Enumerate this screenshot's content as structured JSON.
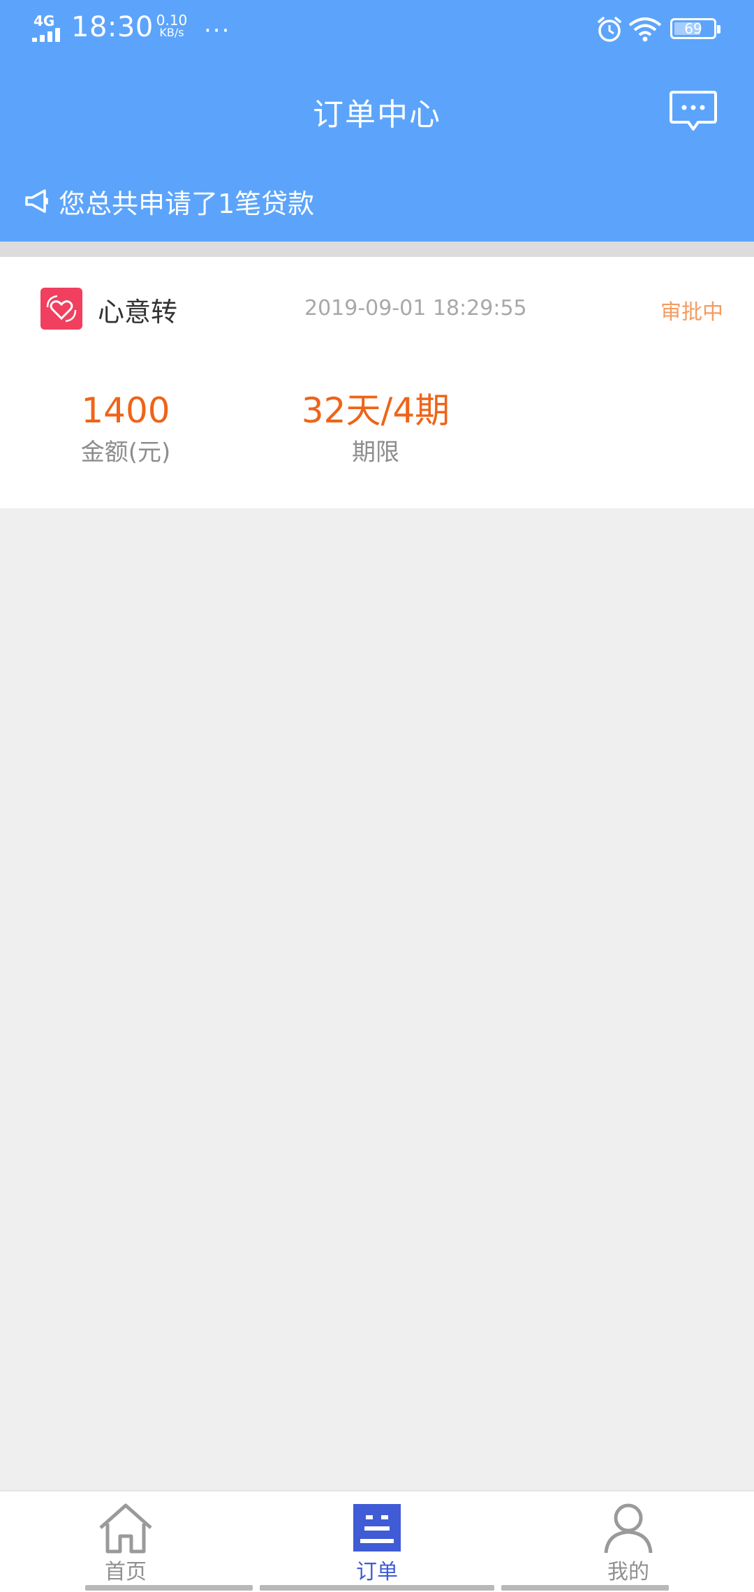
{
  "status_bar": {
    "network": "4G",
    "time": "18:30",
    "speed_value": "0.10",
    "speed_unit": "KB/s",
    "more": "···",
    "battery": "69",
    "battery_level": 0.69
  },
  "header": {
    "title": "订单中心",
    "message_icon": "chat-bubble-icon",
    "notice_icon": "megaphone-icon",
    "notice_text": "您总共申请了1笔贷款"
  },
  "order": {
    "app_icon": "heart-swap-icon",
    "app_name": "心意转",
    "time": "2019-09-01 18:29:55",
    "status": "审批中",
    "amount_value": "1400",
    "amount_label": "金额(元)",
    "term_value": "32天/4期",
    "term_label": "期限"
  },
  "bottom_nav": {
    "items": [
      {
        "label": "首页",
        "icon": "home-icon",
        "active": false
      },
      {
        "label": "订单",
        "icon": "order-list-icon",
        "active": true
      },
      {
        "label": "我的",
        "icon": "profile-icon",
        "active": false
      }
    ]
  },
  "colors": {
    "header_bg": "#5ca4fb",
    "accent_orange": "#ee6418",
    "status_orange": "#f49b61",
    "nav_active": "#3f5bd5",
    "nav_inactive": "#8f8f8f"
  }
}
